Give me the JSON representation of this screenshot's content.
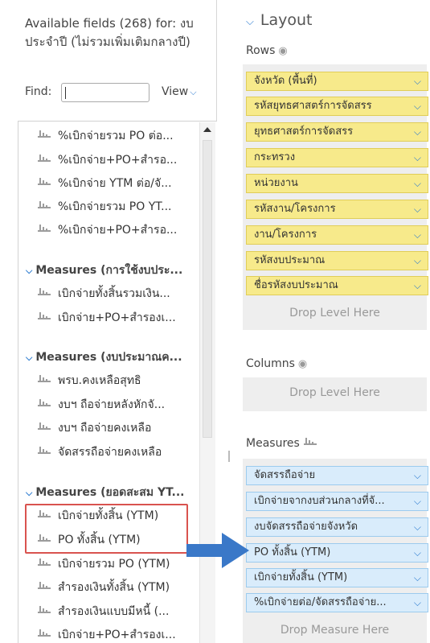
{
  "left_panel": {
    "available_title": "Available fields (268) for: งบประจำปี (ไม่รวมเพิ่มเติมกลางปี)",
    "find_label": "Find:",
    "find_value": "",
    "view_label": "View",
    "fields_top": [
      "%เบิกจ่ายรวม PO ต่อ...",
      "%เบิกจ่าย+PO+สำรอ...",
      "%เบิกจ่าย YTM ต่อ/จั...",
      "%เบิกจ่ายรวม PO YT...",
      "%เบิกจ่าย+PO+สำรอ..."
    ],
    "group1": {
      "label": "Measures (การใช้งบประ...",
      "fields": [
        "เบิกจ่ายทั้งสิ้นรวมเงิน...",
        "เบิกจ่าย+PO+สำรองเ..."
      ]
    },
    "group2": {
      "label": "Measures (งบประมาณค...",
      "fields": [
        "พรบ.คงเหลือสุทธิ",
        "งบฯ ถือจ่ายหลังหักจั...",
        "งบฯ ถือจ่ายคงเหลือ",
        "จัดสรรถือจ่ายคงเหลือ"
      ]
    },
    "group3": {
      "label": "Measures (ยอดสะสม YT...",
      "fields": [
        "เบิกจ่ายทั้งสิ้น (YTM)",
        "PO ทั้งสิ้น (YTM)",
        "เบิกจ่ายรวม PO (YTM)",
        "สำรองเงินทั้งสิ้น (YTM)",
        "สำรองเงินแบบมีหนี้ (...",
        "เบิกจ่าย+PO+สำรองเ..."
      ]
    }
  },
  "right_panel": {
    "layout_title": "Layout",
    "rows_label": "Rows",
    "rows": [
      "จังหวัด (พื้นที่)",
      "รหัสยุทธศาสตร์การจัดสรร",
      "ยุทธศาสตร์การจัดสรร",
      "กระทรวง",
      "หน่วยงาน",
      "รหัสงาน/โครงการ",
      "งาน/โครงการ",
      "รหัสงบประมาณ",
      "ชื่อรหัสงบประมาณ"
    ],
    "rows_drop": "Drop Level Here",
    "columns_label": "Columns",
    "columns_drop": "Drop Level Here",
    "measures_label": "Measures",
    "measures": [
      "จัดสรรถือจ่าย",
      "เบิกจ่ายจากงบส่วนกลางที่จั...",
      "งบจัดสรรถือจ่ายจังหวัด",
      "PO ทั้งสิ้น (YTM)",
      "เบิกจ่ายทั้งสิ้น (YTM)",
      "%เบิกจ่ายต่อ/จัดสรรถือจ่าย..."
    ],
    "measures_drop": "Drop Measure Here"
  },
  "colors": {
    "row_pill": "#f7ea8b",
    "measure_pill": "#d9ecfb",
    "highlight": "#d9534f",
    "arrow": "#3a78c8",
    "chevron": "#2b7bd0"
  }
}
